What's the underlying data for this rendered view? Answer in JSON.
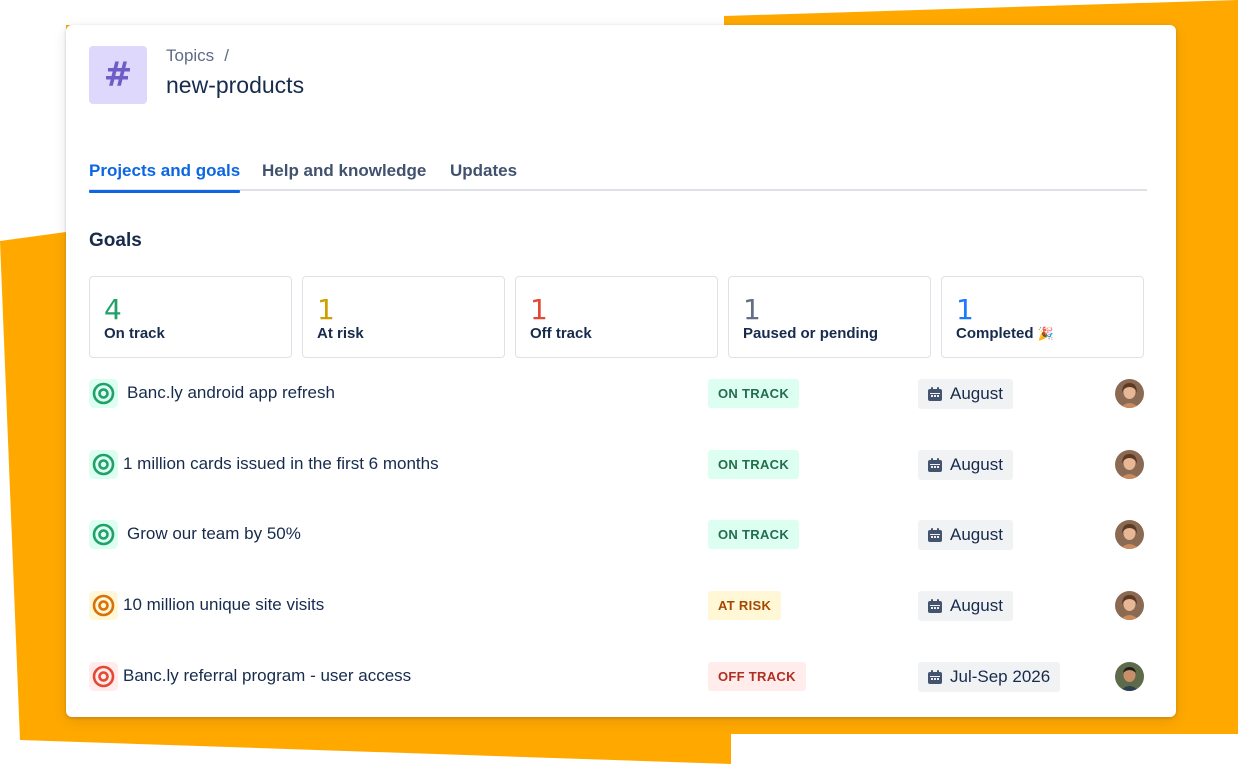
{
  "header": {
    "breadcrumb_parent": "Topics",
    "breadcrumb_sep": "/",
    "title": "new-products",
    "icon": "hash-icon"
  },
  "tabs": [
    {
      "label": "Projects and goals",
      "active": true
    },
    {
      "label": "Help and knowledge",
      "active": false
    },
    {
      "label": "Updates",
      "active": false
    }
  ],
  "goals_section": {
    "title": "Goals",
    "stats": [
      {
        "count": "4",
        "label": "On track",
        "color": "#22a06b"
      },
      {
        "count": "1",
        "label": "At risk",
        "color": "#cf9f02"
      },
      {
        "count": "1",
        "label": "Off track",
        "color": "#e34935"
      },
      {
        "count": "1",
        "label": "Paused or pending",
        "color": "#626f86"
      },
      {
        "count": "1",
        "label": "Completed",
        "color": "#1d7afc",
        "emoji": "🎉"
      }
    ],
    "goals": [
      {
        "name": "Banc.ly android app refresh",
        "status": "ON TRACK",
        "due": "August",
        "avatar": "avatar-woman"
      },
      {
        "name": "1 million cards issued in the first 6 months",
        "status": "ON TRACK",
        "due": "August",
        "avatar": "avatar-woman"
      },
      {
        "name": "Grow our team by 50%",
        "status": "ON TRACK",
        "due": "August",
        "avatar": "avatar-woman"
      },
      {
        "name": "10 million unique site visits",
        "status": "AT RISK",
        "due": "August",
        "avatar": "avatar-woman"
      },
      {
        "name": "Banc.ly referral program - user access",
        "status": "OFF TRACK",
        "due": "Jul-Sep 2026",
        "avatar": "avatar-man"
      }
    ]
  },
  "colors": {
    "accent_orange": "#ffab00",
    "tab_active": "#0c66e4",
    "on_track": "#22a06b",
    "at_risk": "#d97008",
    "off_track": "#e34935"
  }
}
